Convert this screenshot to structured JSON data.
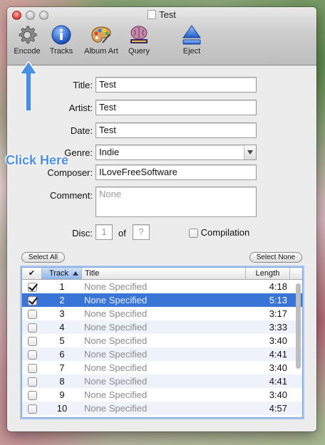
{
  "window": {
    "title": "Test"
  },
  "toolbar": {
    "items": [
      {
        "label": "Encode",
        "icon": "gear-icon"
      },
      {
        "label": "Tracks",
        "icon": "info-icon"
      },
      {
        "label": "Album Art",
        "icon": "palette-icon"
      },
      {
        "label": "Query",
        "icon": "musicbrainz-icon"
      },
      {
        "label": "Eject",
        "icon": "eject-icon"
      }
    ]
  },
  "form": {
    "title_label": "Title:",
    "title_value": "Test",
    "artist_label": "Artist:",
    "artist_value": "Test",
    "date_label": "Date:",
    "date_value": "Test",
    "genre_label": "Genre:",
    "genre_value": "Indie",
    "composer_label": "Composer:",
    "composer_value": "ILoveFreeSoftware",
    "comment_label": "Comment:",
    "comment_placeholder": "None",
    "disc_label": "Disc:",
    "disc_value": "1",
    "of_label": "of",
    "disc_total_placeholder": "?",
    "compilation_label": "Compilation"
  },
  "buttons": {
    "select_all": "Select All",
    "select_none": "Select None"
  },
  "table": {
    "headers": {
      "check": "✔",
      "track": "Track",
      "title": "Title",
      "length": "Length"
    },
    "rows": [
      {
        "checked": true,
        "track": "1",
        "title": "None Specified",
        "length": "4:18"
      },
      {
        "checked": true,
        "track": "2",
        "title": "None Specified",
        "length": "5:13"
      },
      {
        "checked": false,
        "track": "3",
        "title": "None Specified",
        "length": "3:17"
      },
      {
        "checked": false,
        "track": "4",
        "title": "None Specified",
        "length": "3:33"
      },
      {
        "checked": false,
        "track": "5",
        "title": "None Specified",
        "length": "3:40"
      },
      {
        "checked": false,
        "track": "6",
        "title": "None Specified",
        "length": "4:41"
      },
      {
        "checked": false,
        "track": "7",
        "title": "None Specified",
        "length": "3:40"
      },
      {
        "checked": false,
        "track": "8",
        "title": "None Specified",
        "length": "4:41"
      },
      {
        "checked": false,
        "track": "9",
        "title": "None Specified",
        "length": "3:40"
      },
      {
        "checked": false,
        "track": "10",
        "title": "None Specified",
        "length": "4:57"
      }
    ],
    "selected_row": 2
  },
  "annotation": {
    "text": "Click Here",
    "color": "#4a8fe6"
  },
  "colors": {
    "selection": "#3875d7",
    "close": "#e0443a"
  }
}
